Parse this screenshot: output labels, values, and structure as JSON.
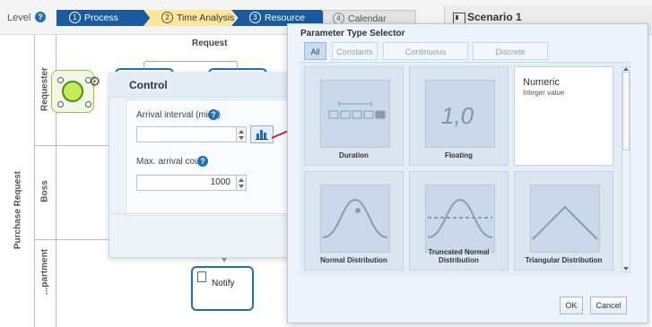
{
  "toolbar": {
    "level_label": "Level",
    "help_glyph": "?",
    "steps": [
      {
        "num": "1",
        "label": "Process Validation"
      },
      {
        "num": "2",
        "label": "Time Analysis"
      },
      {
        "num": "3",
        "label": "Resource Analysis"
      },
      {
        "num": "4",
        "label": "Calendar Analysis"
      }
    ],
    "scenario_label": "Scenario 1"
  },
  "diagram": {
    "pool_label": "Purchase Request",
    "lanes": [
      "Requester",
      "Boss",
      "...partment"
    ],
    "request_label": "Request",
    "notify_label": "Notify"
  },
  "control": {
    "title": "Control",
    "arrival_label": "Arrival interval (mins)",
    "arrival_value": "",
    "max_label": "Max. arrival count",
    "max_value": "1000"
  },
  "selector": {
    "title": "Parameter Type Selector",
    "filters": [
      "All",
      "Constants",
      "Continuous distributions",
      "Discrete distributions"
    ],
    "tiles": {
      "duration": "Duration",
      "floating": "Floating",
      "floating_glyph": "1,0",
      "numeric_title": "Numeric",
      "numeric_sub": "Integer value",
      "normal": "Normal Distribution",
      "truncated": "Truncated Normal Distribution",
      "triangular": "Triangular Distribution"
    },
    "ok_label": "OK",
    "cancel_label": "Cancel"
  },
  "colors": {
    "accent_blue": "#1a5aa0",
    "active_step": "#fbe79a",
    "start_event_green": "#c2eb56",
    "arrow_red": "#d42020"
  }
}
